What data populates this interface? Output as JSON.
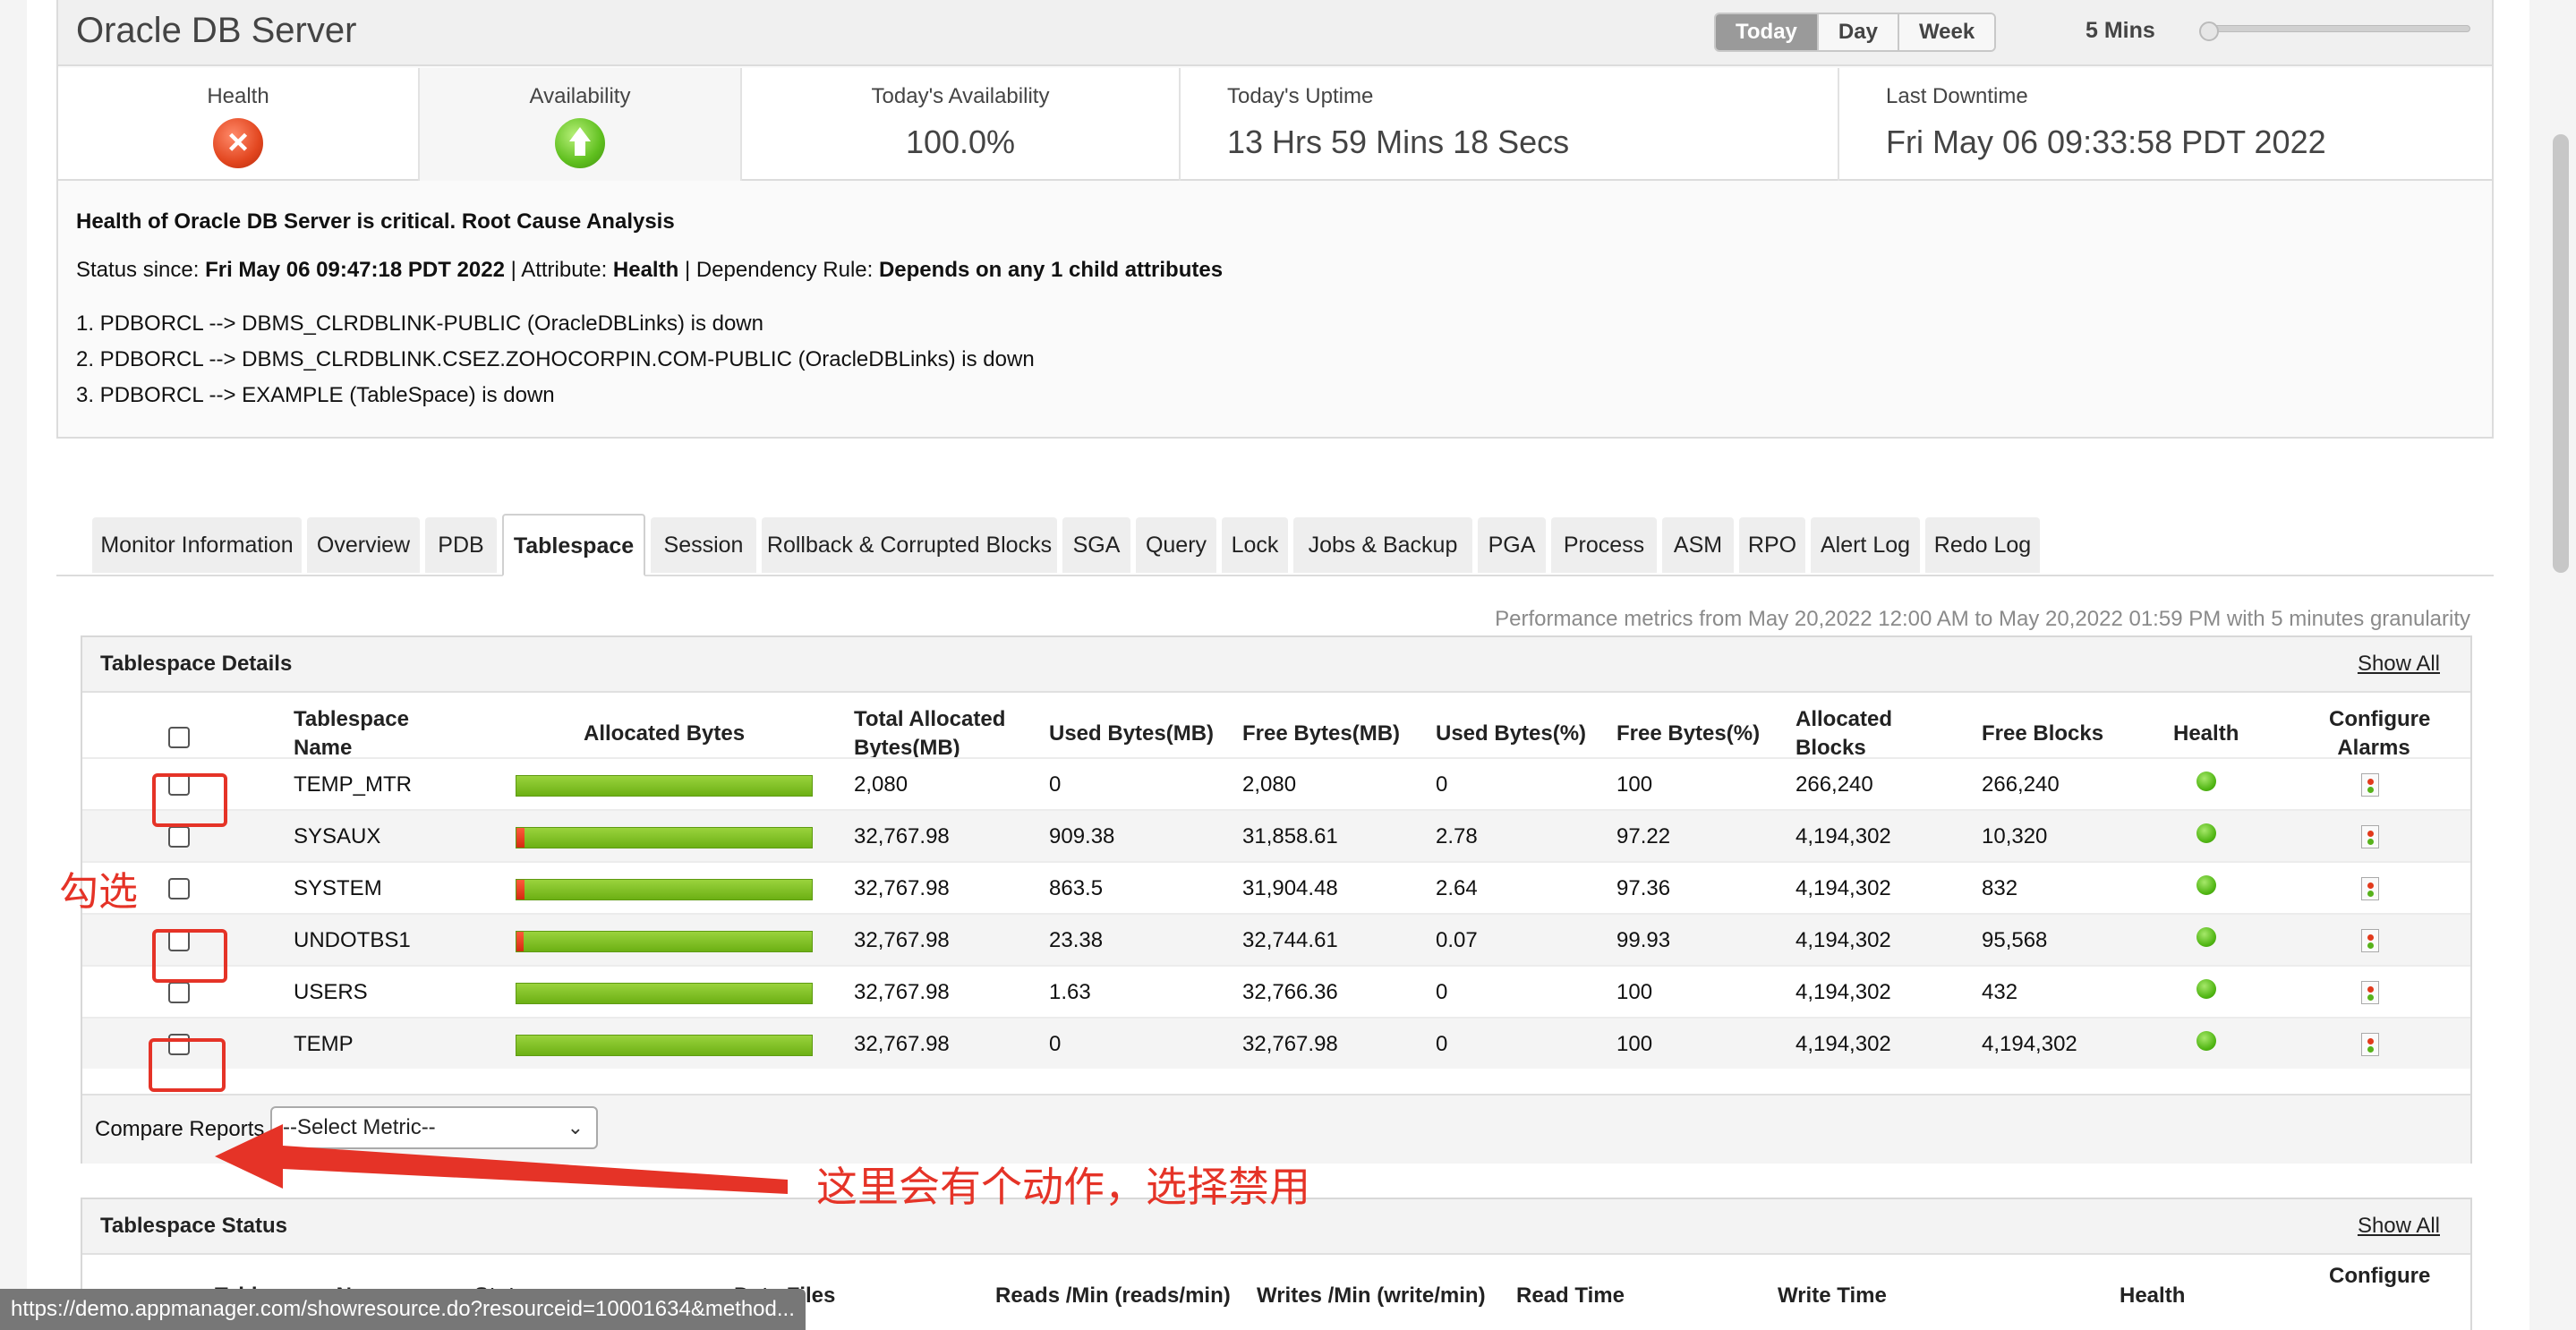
{
  "header": {
    "title": "Oracle DB Server",
    "ranges": [
      "Today",
      "Day",
      "Week"
    ],
    "active_range": "Today",
    "granularity": "5 Mins"
  },
  "stats": {
    "health_label": "Health",
    "availability_label": "Availability",
    "todays_availability_label": "Today's Availability",
    "todays_availability_value": "100.0%",
    "uptime_label": "Today's Uptime",
    "uptime_value": "13 Hrs 59 Mins 18 Secs",
    "last_downtime_label": "Last Downtime",
    "last_downtime_value": "Fri May 06 09:33:58 PDT 2022"
  },
  "rca": {
    "title": "Health of Oracle DB Server is critical. Root Cause Analysis",
    "status_since_label": "Status since: ",
    "status_since_value": "Fri May 06 09:47:18 PDT 2022",
    "attribute_label": " | Attribute: ",
    "attribute_value": "Health",
    "dependency_label": " | Dependency Rule: ",
    "dependency_value": "Depends on any 1 child attributes",
    "items": [
      "1. PDBORCL --> DBMS_CLRDBLINK-PUBLIC (OracleDBLinks) is down",
      "2. PDBORCL --> DBMS_CLRDBLINK.CSEZ.ZOHOCORPIN.COM-PUBLIC (OracleDBLinks) is down",
      "3. PDBORCL --> EXAMPLE (TableSpace) is down"
    ]
  },
  "tabs": [
    "Monitor Information",
    "Overview",
    "PDB",
    "Tablespace",
    "Session",
    "Rollback & Corrupted Blocks",
    "SGA",
    "Query",
    "Lock",
    "Jobs & Backup",
    "PGA",
    "Process",
    "ASM",
    "RPO",
    "Alert Log",
    "Redo Log"
  ],
  "active_tab": "Tablespace",
  "perf_note": "Performance metrics from May 20,2022 12:00 AM to May 20,2022 01:59 PM with 5 minutes granularity",
  "tablespace_details": {
    "title": "Tablespace Details",
    "show_all": "Show All",
    "headers": {
      "name_1": "Tablespace",
      "name_2": "Name",
      "allocated": "Allocated Bytes",
      "total_1": "Total Allocated",
      "total_2": "Bytes(MB)",
      "used": "Used Bytes(MB)",
      "free": "Free Bytes(MB)",
      "used_pct": "Used Bytes(%)",
      "free_pct": "Free Bytes(%)",
      "alloc_blocks_1": "Allocated",
      "alloc_blocks_2": "Blocks",
      "free_blocks": "Free Blocks",
      "health": "Health",
      "configure_1": "Configure",
      "configure_2": "Alarms"
    },
    "rows": [
      {
        "name": "TEMP_MTR",
        "used_fraction": 0.0,
        "total": "2,080",
        "used": "0",
        "free": "2,080",
        "used_pct": "0",
        "free_pct": "100",
        "alloc_blocks": "266,240",
        "free_blocks": "266,240"
      },
      {
        "name": "SYSAUX",
        "used_fraction": 0.0278,
        "total": "32,767.98",
        "used": "909.38",
        "free": "31,858.61",
        "used_pct": "2.78",
        "free_pct": "97.22",
        "alloc_blocks": "4,194,302",
        "free_blocks": "10,320"
      },
      {
        "name": "SYSTEM",
        "used_fraction": 0.0264,
        "total": "32,767.98",
        "used": "863.5",
        "free": "31,904.48",
        "used_pct": "2.64",
        "free_pct": "97.36",
        "alloc_blocks": "4,194,302",
        "free_blocks": "832"
      },
      {
        "name": "UNDOTBS1",
        "used_fraction": 0.0007,
        "total": "32,767.98",
        "used": "23.38",
        "free": "32,744.61",
        "used_pct": "0.07",
        "free_pct": "99.93",
        "alloc_blocks": "4,194,302",
        "free_blocks": "95,568"
      },
      {
        "name": "USERS",
        "used_fraction": 0.0,
        "total": "32,767.98",
        "used": "1.63",
        "free": "32,766.36",
        "used_pct": "0",
        "free_pct": "100",
        "alloc_blocks": "4,194,302",
        "free_blocks": "432"
      },
      {
        "name": "TEMP",
        "used_fraction": 0.0,
        "total": "32,767.98",
        "used": "0",
        "free": "32,767.98",
        "used_pct": "0",
        "free_pct": "100",
        "alloc_blocks": "4,194,302",
        "free_blocks": "4,194,302"
      }
    ],
    "compare_label": "Compare Reports",
    "select_value": "--Select Metric--"
  },
  "tablespace_status": {
    "title": "Tablespace Status",
    "show_all": "Show All",
    "headers": [
      "Tablespace Name",
      "Status",
      "Data Files",
      "Reads /Min (reads/min)",
      "Writes /Min (write/min)",
      "Read Time",
      "Write Time",
      "Health",
      "Configure"
    ]
  },
  "annotations": {
    "check_text": "勾选",
    "action_text": "这里会有个动作，选择禁用",
    "color": "#e53327"
  },
  "status_url": "https://demo.appmanager.com/showresource.do?resourceid=10001634&method..."
}
